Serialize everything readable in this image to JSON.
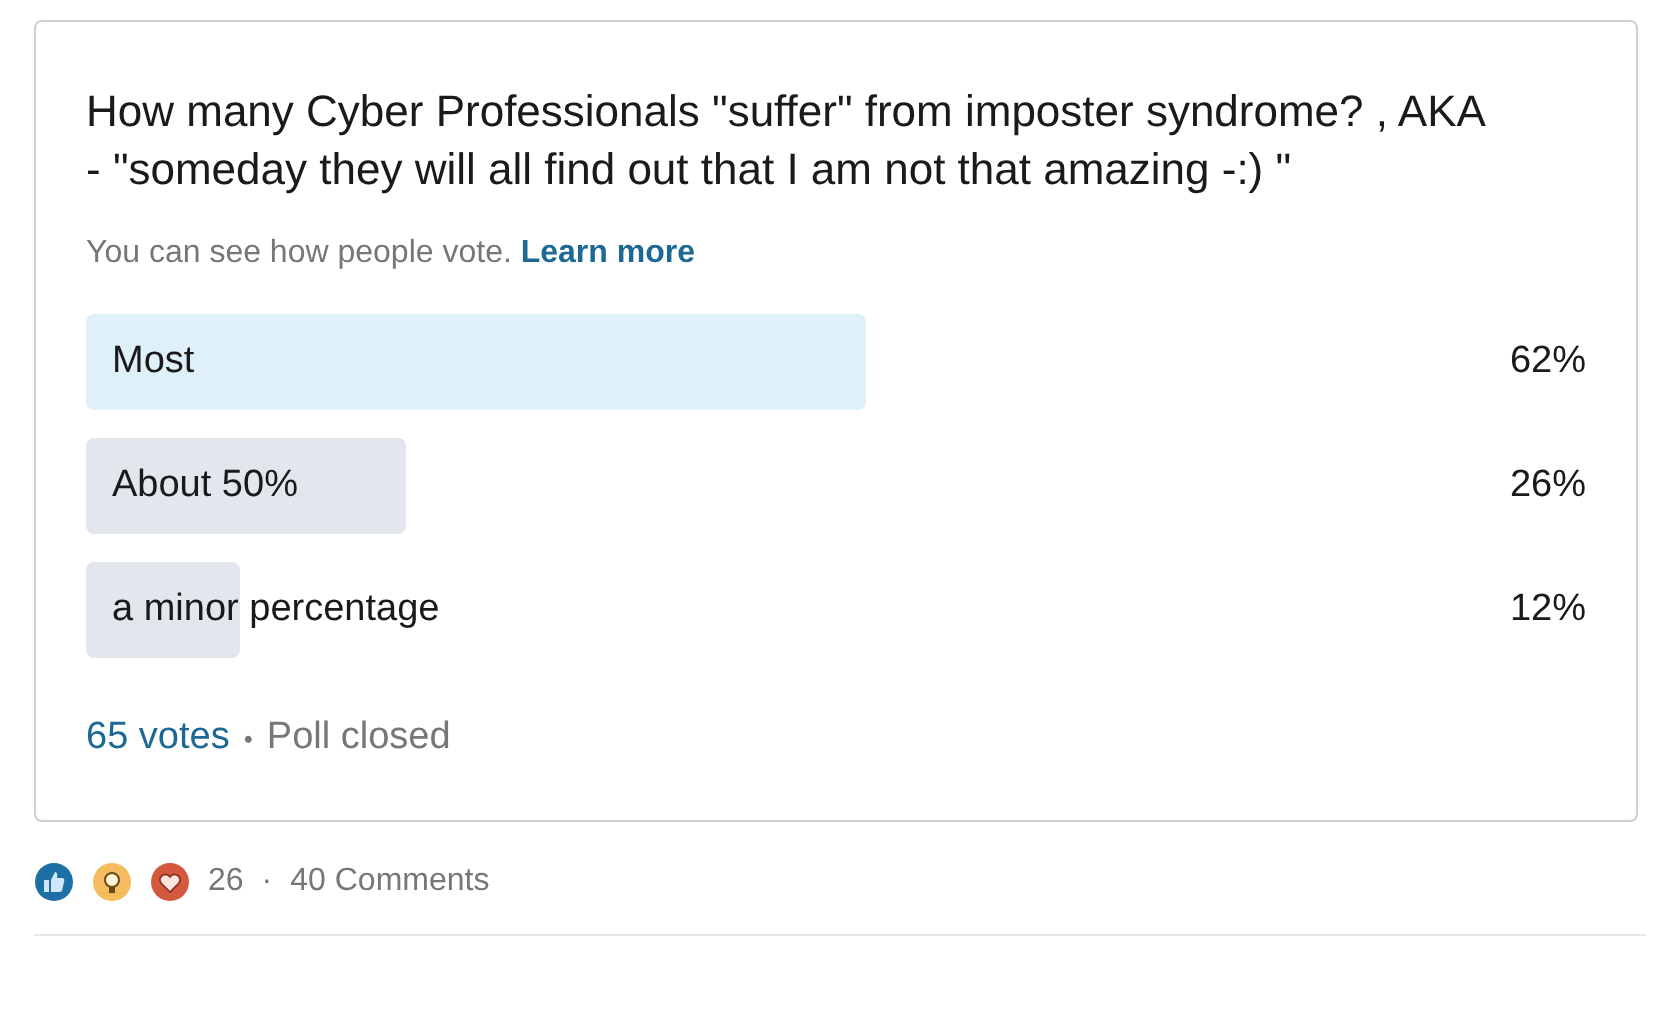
{
  "poll": {
    "question": "How many Cyber Professionals \"suffer\" from imposter syndrome? , AKA - \"someday they will all find out that I am not that amazing -:) \"",
    "visibility_note": "You can see how people vote.",
    "learn_more": "Learn more",
    "options": [
      {
        "label": "Most",
        "percent": "62%",
        "level": 0.52,
        "selected": true
      },
      {
        "label": "About 50%",
        "percent": "26%",
        "level": 0.213,
        "selected": false
      },
      {
        "label": "a minor percentage",
        "percent": "12%",
        "level": 0.103,
        "selected": false
      }
    ],
    "votes": "65 votes",
    "separator": "•",
    "status": "Poll closed"
  },
  "social": {
    "reactions": [
      {
        "kind": "like"
      },
      {
        "kind": "insightful"
      },
      {
        "kind": "love"
      }
    ],
    "reaction_count": "26",
    "separator": "·",
    "comments": "40 Comments"
  }
}
